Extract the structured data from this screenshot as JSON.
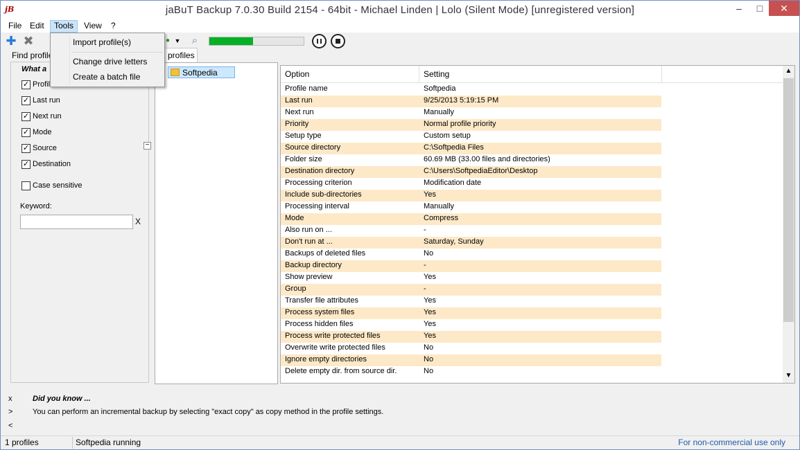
{
  "window": {
    "title": "jaBuT Backup 7.0.30 Build 2154 - 64bit - Michael Linden    |    Lolo (Silent Mode) [unregistered version]",
    "app_icon_text": "jB",
    "minimize": "–",
    "maximize": "□",
    "close": "✕"
  },
  "menu": {
    "file": "File",
    "edit": "Edit",
    "tools": "Tools",
    "view": "View",
    "help": "?"
  },
  "tools_menu": {
    "items": [
      "Import profile(s)",
      "Change drive letters",
      "Create a batch file"
    ]
  },
  "toolbar": {
    "progress_percent": 46
  },
  "left_panel": {
    "tab": "Find profile",
    "heading": "What a",
    "options": [
      {
        "label": "Profile name",
        "checked": true
      },
      {
        "label": "Last run",
        "checked": true
      },
      {
        "label": "Next run",
        "checked": true
      },
      {
        "label": "Mode",
        "checked": true
      },
      {
        "label": "Source",
        "checked": true
      },
      {
        "label": "Destination",
        "checked": true
      }
    ],
    "case_sensitive": {
      "label": "Case sensitive",
      "checked": false
    },
    "keyword_label": "Keyword:",
    "keyword_value": "",
    "keyword_clear": "X",
    "collapse": "−"
  },
  "profiles": {
    "tab": "profiles",
    "tree_items": [
      "Softpedia"
    ]
  },
  "grid": {
    "col_option": "Option",
    "col_setting": "Setting",
    "rows": [
      {
        "option": "Profile name",
        "setting": "Softpedia"
      },
      {
        "option": "Last run",
        "setting": "9/25/2013 5:19:15 PM"
      },
      {
        "option": "Next run",
        "setting": "Manually"
      },
      {
        "option": "Priority",
        "setting": "Normal profile priority"
      },
      {
        "option": "Setup type",
        "setting": "Custom setup"
      },
      {
        "option": "Source directory",
        "setting": "C:\\Softpedia Files"
      },
      {
        "option": "Folder size",
        "setting": "60.69 MB (33.00 files and directories)"
      },
      {
        "option": "Destination directory",
        "setting": "C:\\Users\\SoftpediaEditor\\Desktop"
      },
      {
        "option": "Processing criterion",
        "setting": "Modification date"
      },
      {
        "option": "Include sub-directories",
        "setting": "Yes"
      },
      {
        "option": "Processing interval",
        "setting": "Manually"
      },
      {
        "option": "Mode",
        "setting": "Compress"
      },
      {
        "option": "Also run on ...",
        "setting": "-"
      },
      {
        "option": "Don't run at ...",
        "setting": "Saturday, Sunday"
      },
      {
        "option": "Backups of deleted files",
        "setting": "No"
      },
      {
        "option": "Backup directory",
        "setting": "-"
      },
      {
        "option": "Show preview",
        "setting": "Yes"
      },
      {
        "option": "Group",
        "setting": "-"
      },
      {
        "option": "Transfer file attributes",
        "setting": "Yes"
      },
      {
        "option": "Process system files",
        "setting": "Yes"
      },
      {
        "option": "Process hidden files",
        "setting": "Yes"
      },
      {
        "option": "Process write protected files",
        "setting": "Yes"
      },
      {
        "option": "Overwrite write protected files",
        "setting": "No"
      },
      {
        "option": "Ignore empty directories",
        "setting": "No"
      },
      {
        "option": "Delete empty dir. from source dir.",
        "setting": "No"
      }
    ]
  },
  "tips": {
    "close": "x",
    "next": ">",
    "prev": "<",
    "title": "Did you know ...",
    "text": "You can perform an incremental backup by selecting \"exact copy\" as copy method in the profile settings."
  },
  "status": {
    "profiles": "1 profiles",
    "running": "Softpedia running",
    "license": "For non-commercial use only"
  },
  "colors": {
    "alt_row": "#fde9c8",
    "progress": "#06b025",
    "close_button": "#c75050"
  }
}
